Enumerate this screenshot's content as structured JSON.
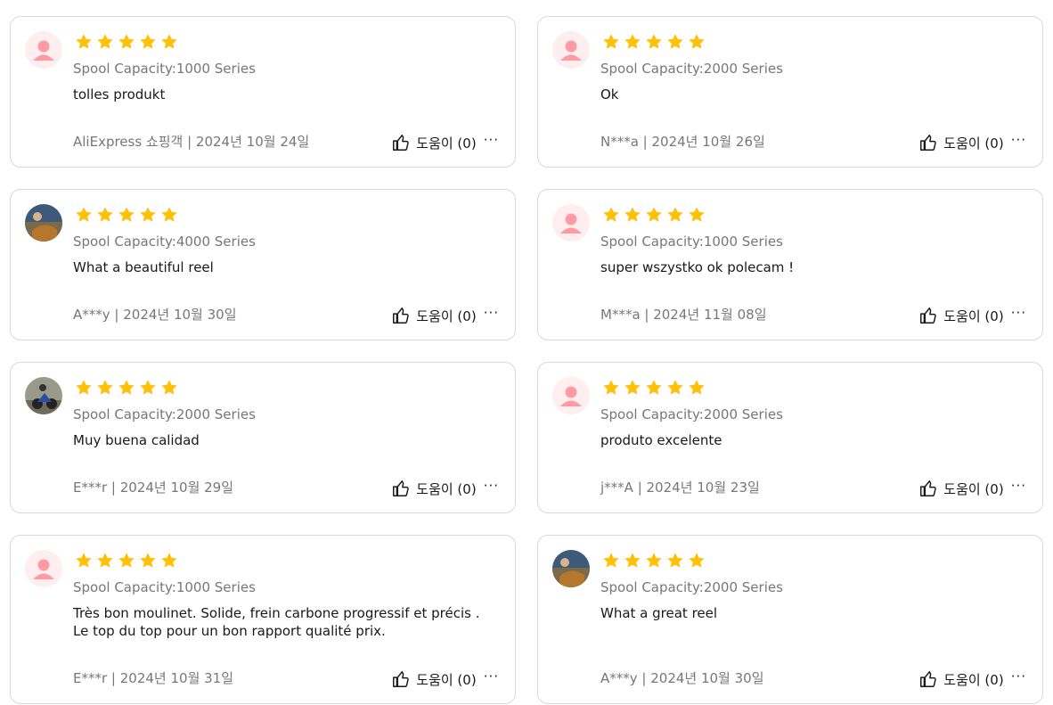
{
  "colors": {
    "star": "#ffc107",
    "border": "#d9d9d9",
    "muted_text": "#777777",
    "body_text": "#191919",
    "default_avatar_bg": "#ffeef0",
    "default_avatar_fg": "#ff9aa2"
  },
  "helpful_icon": "thumbs-up-icon",
  "more_icon": "more-icon",
  "reviews": [
    {
      "rating": 5,
      "spec": "Spool Capacity:1000 Series",
      "text": "tolles produkt",
      "author_date": "AliExpress 쇼핑객 | 2024년 10월 24일",
      "helpful": "도움이 (0)",
      "more": "···",
      "avatar": "default-avatar-icon"
    },
    {
      "rating": 5,
      "spec": "Spool Capacity:2000 Series",
      "text": "Ok",
      "author_date": "N***a | 2024년 10월 26일",
      "helpful": "도움이 (0)",
      "more": "···",
      "avatar": "default-avatar-icon"
    },
    {
      "rating": 5,
      "spec": "Spool Capacity:4000 Series",
      "text": "What a beautiful reel",
      "author_date": "A***y | 2024년 10월 30일",
      "helpful": "도움이 (0)",
      "more": "···",
      "avatar": "user-photo-avatar"
    },
    {
      "rating": 5,
      "spec": "Spool Capacity:1000 Series",
      "text": "super wszystko ok polecam !",
      "author_date": "M***a | 2024년 11월 08일",
      "helpful": "도움이 (0)",
      "more": "···",
      "avatar": "default-avatar-icon"
    },
    {
      "rating": 5,
      "spec": "Spool Capacity:2000 Series",
      "text": "Muy buena calidad",
      "author_date": "E***r | 2024년 10월 29일",
      "helpful": "도움이 (0)",
      "more": "···",
      "avatar": "user-photo-avatar"
    },
    {
      "rating": 5,
      "spec": "Spool Capacity:2000 Series",
      "text": "produto excelente",
      "author_date": "j***A | 2024년 10월 23일",
      "helpful": "도움이 (0)",
      "more": "···",
      "avatar": "default-avatar-icon"
    },
    {
      "rating": 5,
      "spec": "Spool Capacity:1000 Series",
      "text": "Très bon moulinet. Solide, frein carbone progressif et précis . Le top du top pour un bon rapport qualité prix.",
      "author_date": "E***r | 2024년 10월 31일",
      "helpful": "도움이 (0)",
      "more": "···",
      "avatar": "default-avatar-icon"
    },
    {
      "rating": 5,
      "spec": "Spool Capacity:2000 Series",
      "text": "What a great reel",
      "author_date": "A***y | 2024년 10월 30일",
      "helpful": "도움이 (0)",
      "more": "···",
      "avatar": "user-photo-avatar"
    }
  ]
}
